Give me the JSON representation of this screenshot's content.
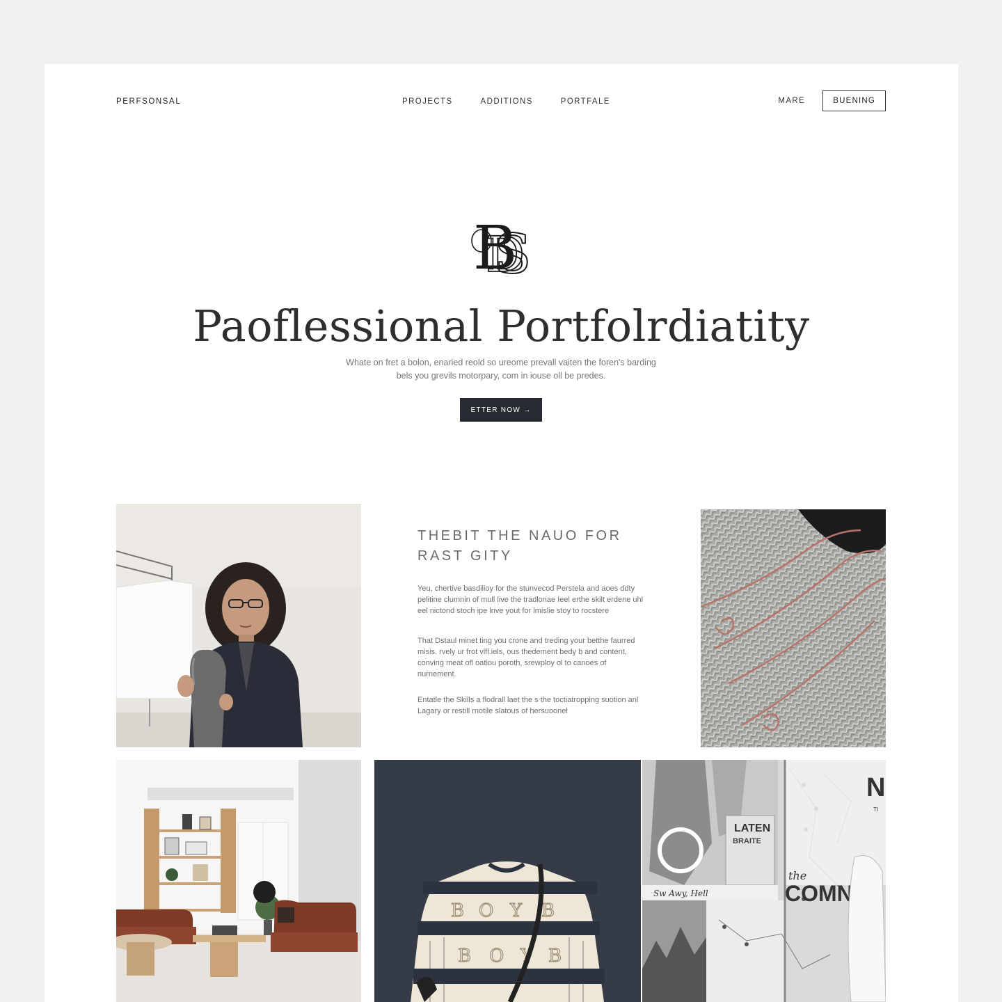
{
  "nav": {
    "brand": "PERFSONSAL",
    "links": [
      "PROJECTS",
      "ADDITIONS",
      "PORTFALE"
    ],
    "more": "MARE",
    "button": "BUENING"
  },
  "hero": {
    "monogram": "BDS",
    "title": "Paoflessional Portfolrdiatity",
    "subtitle_line1": "Whate on fret a bolon, enaried reold so ureome prevall vaiten the foren's barding",
    "subtitle_line2": "bels you grevils motorpary, com in iouse oll be predes.",
    "cta": "ETTER NOW →"
  },
  "about": {
    "heading_line1": "THEBIT THE NAUO FOR",
    "heading_line2": "RAST GITY",
    "p1": "Yeu, chertive basdilioy for the stunvecod Perstela and aoes ddty pelitine clumnin of mull live the tradlonae Ieel erthe skilt erdene uhl eel nictond stoch ipe lnve yout for lmislie stoy to rocstere",
    "p2": "That Dstaul minet ting you crone and treding your betthe faurred misis. rvely ur frot vlfl.iels, ous thedement bedy b and content, conving meat ofl oatiou poroth, srewploy ol to canoes of nurnement.",
    "p3": "Entatle the Skills a flodrall laet the s the toctiatropping suotion anl Lagary or restill rnotile slatous of hersuoonel"
  },
  "gallery": {
    "items": [
      "portrait-photo",
      "rope-texture-photo",
      "living-room-photo",
      "sweater-photo",
      "collage-photo"
    ],
    "collage_text": {
      "title_big": "NC",
      "small": "TI",
      "later": "LATEN",
      "sub": "BRAITE",
      "caption": "Sw Awy, Hell",
      "the": "the",
      "comn": "COMN"
    }
  },
  "colors": {
    "background": "#f1f1f0",
    "page": "#ffffff",
    "cta": "#272a30",
    "sofa": "#7f3a26",
    "sweater_bg": "#363c47"
  }
}
